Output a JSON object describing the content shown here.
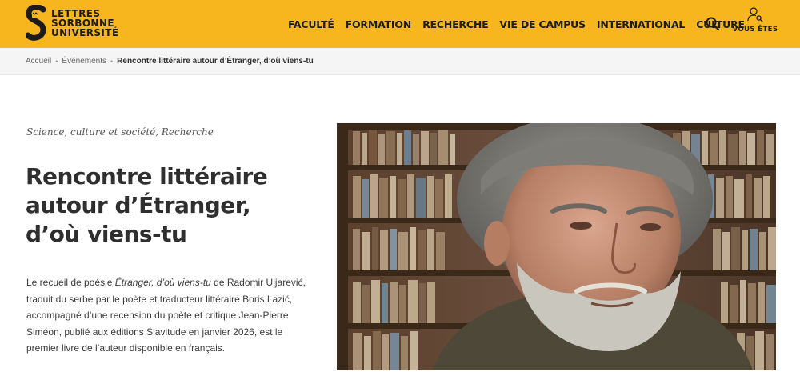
{
  "header": {
    "logo_lines": [
      "LETTRES",
      "SORBONNE",
      "UNIVERSITÉ"
    ],
    "nav": [
      "FACULTÉ",
      "FORMATION",
      "RECHERCHE",
      "VIE DE CAMPUS",
      "INTERNATIONAL",
      "CULTURE"
    ],
    "search_icon": "search-icon",
    "you_label": "VOUS ÊTES",
    "brand_color": "#f7b51e"
  },
  "breadcrumb": {
    "items": [
      "Accueil",
      "Événements"
    ],
    "current": "Rencontre littéraire autour d’Étranger, d’où viens-tu"
  },
  "article": {
    "category": "Science, culture et société, Recherche",
    "title_lines": [
      "Rencontre littéraire",
      "autour d’Étranger,",
      "d’où viens-tu"
    ],
    "desc_intro": "Le recueil de poésie ",
    "desc_book": "Étranger, d’où viens-tu",
    "desc_rest": " de Radomir Uljarević, traduit du serbe par le poète et traducteur littéraire Boris Lazić, accompagné d’une recension du poète et critique Jean-Pierre Siméon, publié aux éditions Slavitude en janvier 2026, est le premier livre de l’auteur disponible en français."
  }
}
